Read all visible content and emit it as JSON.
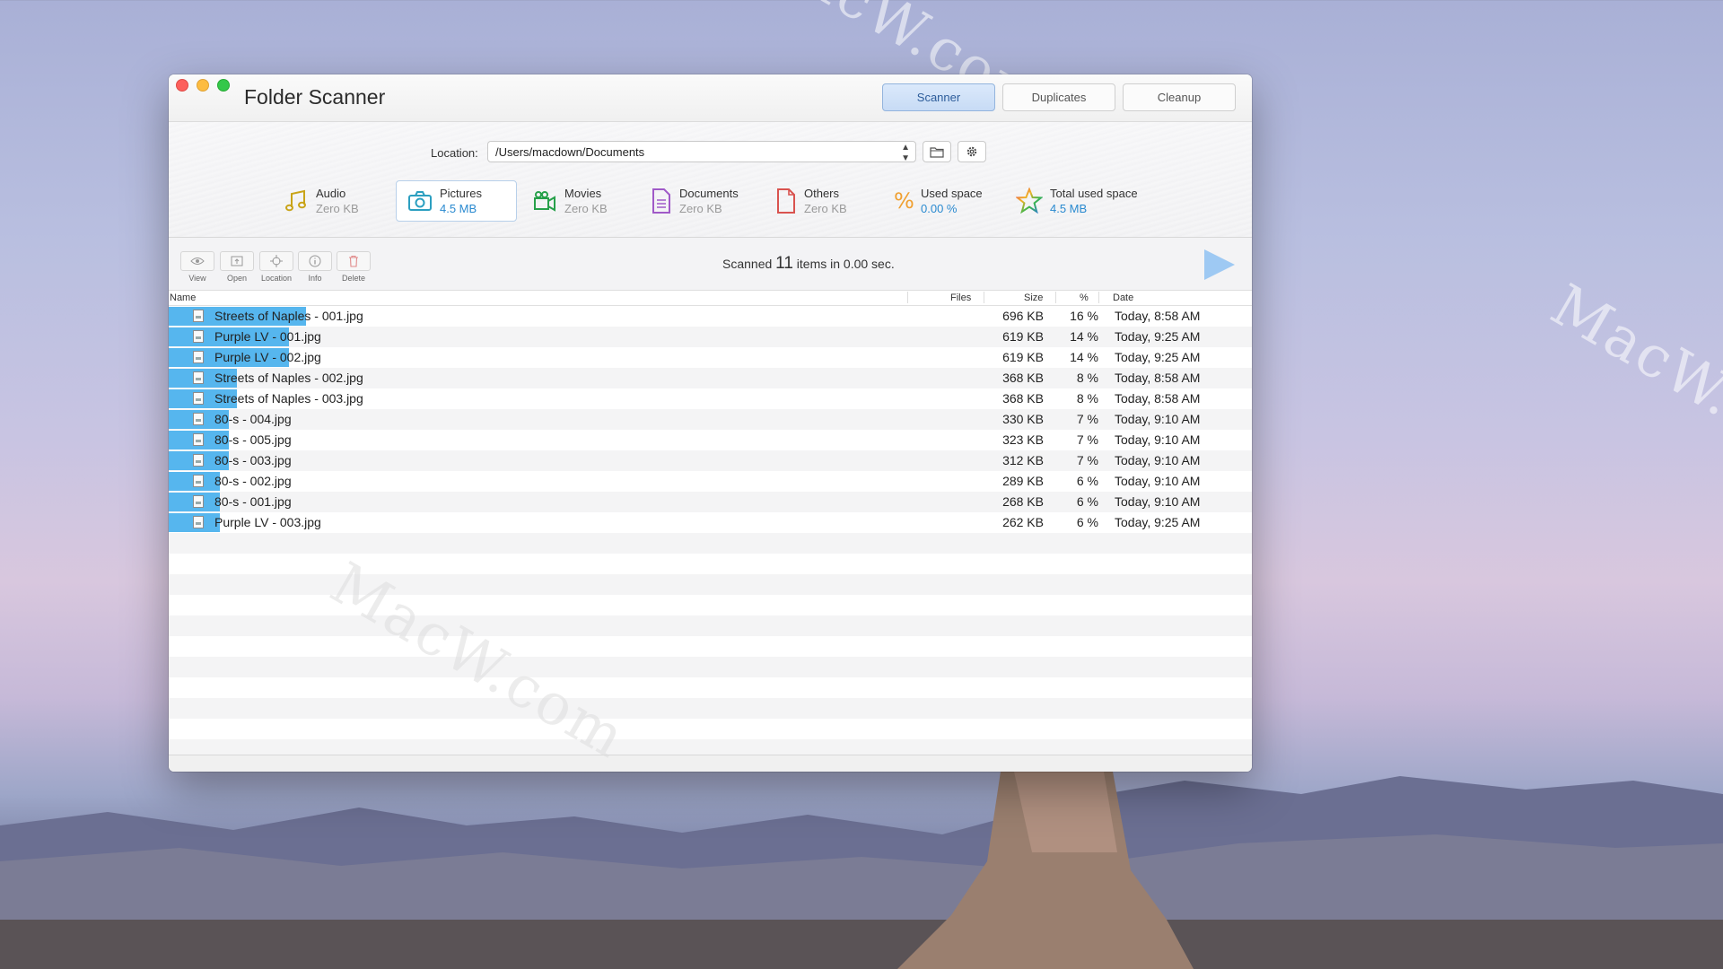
{
  "window": {
    "title": "Folder Scanner"
  },
  "tabs": [
    {
      "label": "Scanner",
      "active": true
    },
    {
      "label": "Duplicates",
      "active": false
    },
    {
      "label": "Cleanup",
      "active": false
    }
  ],
  "location": {
    "label": "Location:",
    "value": "/Users/macdown/Documents"
  },
  "categories": [
    {
      "name": "Audio",
      "value": "Zero KB",
      "icon": "music-note-icon"
    },
    {
      "name": "Pictures",
      "value": "4.5 MB",
      "icon": "camera-icon"
    },
    {
      "name": "Movies",
      "value": "Zero KB",
      "icon": "video-camera-icon"
    },
    {
      "name": "Documents",
      "value": "Zero KB",
      "icon": "document-icon"
    },
    {
      "name": "Others",
      "value": "Zero KB",
      "icon": "file-icon"
    },
    {
      "name": "Used space",
      "value": "0.00 %",
      "icon": "percent-icon"
    },
    {
      "name": "Total used space",
      "value": "4.5 MB",
      "icon": "star-icon"
    }
  ],
  "toolbar": {
    "view": "View",
    "open": "Open",
    "location": "Location",
    "info": "Info",
    "delete": "Delete"
  },
  "status": {
    "prefix": "Scanned",
    "count": "11",
    "suffix": "items in 0.00 sec."
  },
  "columns": {
    "name": "Name",
    "files": "Files",
    "size": "Size",
    "percent": "%",
    "date": "Date"
  },
  "files": [
    {
      "name": "Streets of Naples - 001.jpg",
      "size": "696 KB",
      "percent": "16 %",
      "date": "Today, 8:58 AM",
      "fraction": 0.16
    },
    {
      "name": "Purple LV - 001.jpg",
      "size": "619 KB",
      "percent": "14 %",
      "date": "Today, 9:25 AM",
      "fraction": 0.14
    },
    {
      "name": "Purple LV - 002.jpg",
      "size": "619 KB",
      "percent": "14 %",
      "date": "Today, 9:25 AM",
      "fraction": 0.14
    },
    {
      "name": "Streets of Naples - 002.jpg",
      "size": "368 KB",
      "percent": "8 %",
      "date": "Today, 8:58 AM",
      "fraction": 0.08
    },
    {
      "name": "Streets of Naples - 003.jpg",
      "size": "368 KB",
      "percent": "8 %",
      "date": "Today, 8:58 AM",
      "fraction": 0.08
    },
    {
      "name": "80-s - 004.jpg",
      "size": "330 KB",
      "percent": "7 %",
      "date": "Today, 9:10 AM",
      "fraction": 0.07
    },
    {
      "name": "80-s - 005.jpg",
      "size": "323 KB",
      "percent": "7 %",
      "date": "Today, 9:10 AM",
      "fraction": 0.07
    },
    {
      "name": "80-s - 003.jpg",
      "size": "312 KB",
      "percent": "7 %",
      "date": "Today, 9:10 AM",
      "fraction": 0.07
    },
    {
      "name": "80-s - 002.jpg",
      "size": "289 KB",
      "percent": "6 %",
      "date": "Today, 9:10 AM",
      "fraction": 0.06
    },
    {
      "name": "80-s - 001.jpg",
      "size": "268 KB",
      "percent": "6 %",
      "date": "Today, 9:10 AM",
      "fraction": 0.06
    },
    {
      "name": "Purple LV - 003.jpg",
      "size": "262 KB",
      "percent": "6 %",
      "date": "Today, 9:25 AM",
      "fraction": 0.06
    }
  ],
  "watermark": "MacW.com",
  "colors": {
    "accent": "#56b6ee",
    "pictures_value": "#2a8ad0",
    "play": "#9ec9f3"
  }
}
